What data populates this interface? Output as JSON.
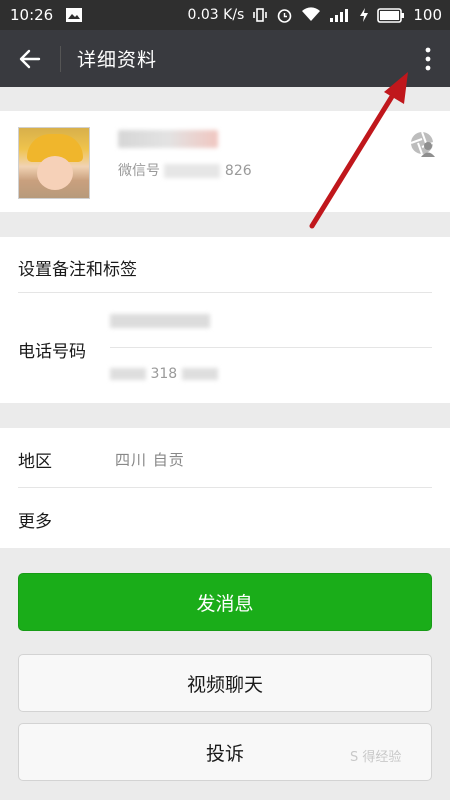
{
  "status": {
    "time": "10:26",
    "speed": "0.03 K/s",
    "battery": "100"
  },
  "nav": {
    "title": "详细资料"
  },
  "profile": {
    "wechat_id_prefix": "微信号",
    "wechat_id_suffix": "826"
  },
  "rows": {
    "remark_label": "设置备注和标签",
    "phone_label": "电话号码",
    "phone_visible_digits": "318",
    "region_label": "地区",
    "region_value": "四川  自贡",
    "more_label": "更多"
  },
  "buttons": {
    "send_message": "发消息",
    "video_chat": "视频聊天",
    "report": "投诉"
  },
  "colors": {
    "header": "#393a3f",
    "primary_green": "#1aad19",
    "annotation_arrow": "#c0171c"
  },
  "watermark": "S 得经验"
}
